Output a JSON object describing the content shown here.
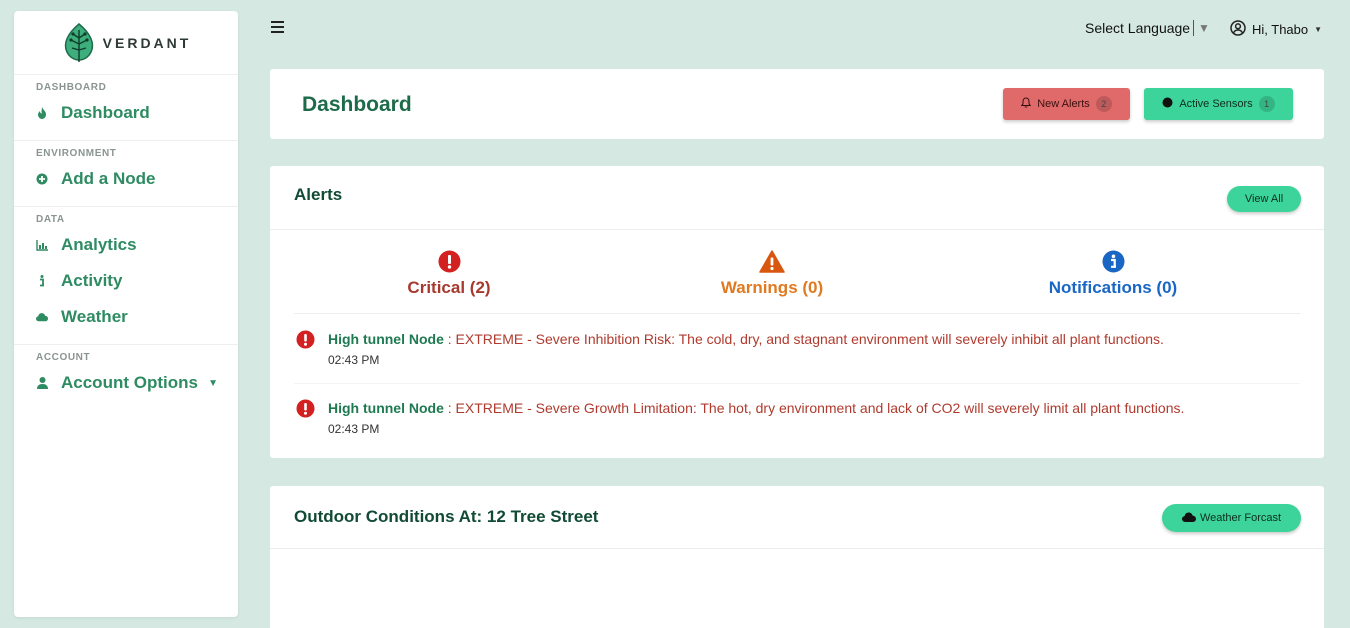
{
  "brand": {
    "name": "VERDANT"
  },
  "sidebar": {
    "sections": [
      {
        "heading": "DASHBOARD",
        "items": [
          {
            "label": "Dashboard",
            "icon": "fire-icon"
          }
        ]
      },
      {
        "heading": "ENVIRONMENT",
        "items": [
          {
            "label": "Add a Node",
            "icon": "plus-circle-icon"
          }
        ]
      },
      {
        "heading": "DATA",
        "items": [
          {
            "label": "Analytics",
            "icon": "bar-chart-icon"
          },
          {
            "label": "Activity",
            "icon": "info-icon"
          },
          {
            "label": "Weather",
            "icon": "cloud-icon"
          }
        ]
      },
      {
        "heading": "ACCOUNT",
        "items": [
          {
            "label": "Account Options",
            "icon": "user-icon"
          }
        ]
      }
    ]
  },
  "topbar": {
    "language_label": "Select Language",
    "user_greeting": "Hi, Thabo"
  },
  "header": {
    "title": "Dashboard",
    "new_alerts_label": "New Alerts",
    "new_alerts_count": "2",
    "active_sensors_label": "Active Sensors",
    "active_sensors_count": "1"
  },
  "alerts": {
    "title": "Alerts",
    "view_all_label": "View All",
    "summary": {
      "critical": "Critical (2)",
      "warnings": "Warnings (0)",
      "notifications": "Notifications (0)"
    },
    "items": [
      {
        "node": "High tunnel Node",
        "message": " : EXTREME - Severe Inhibition Risk: The cold, dry, and stagnant environment will severely inhibit all plant functions.",
        "time": "02:43 PM"
      },
      {
        "node": "High tunnel Node",
        "message": " : EXTREME - Severe Growth Limitation: The hot, dry environment and lack of CO2 will severely limit all plant functions.",
        "time": "02:43 PM"
      }
    ]
  },
  "outdoor": {
    "title": "Outdoor Conditions At: 12 Tree Street",
    "weather_button_label": "Weather Forcast"
  },
  "colors": {
    "primary": "#2e8b62",
    "accent": "#3dd49b",
    "danger": "#e06a6a",
    "critical": "#d32020",
    "warning": "#e06010",
    "info": "#1a66c4",
    "background": "#d5e9e2"
  }
}
